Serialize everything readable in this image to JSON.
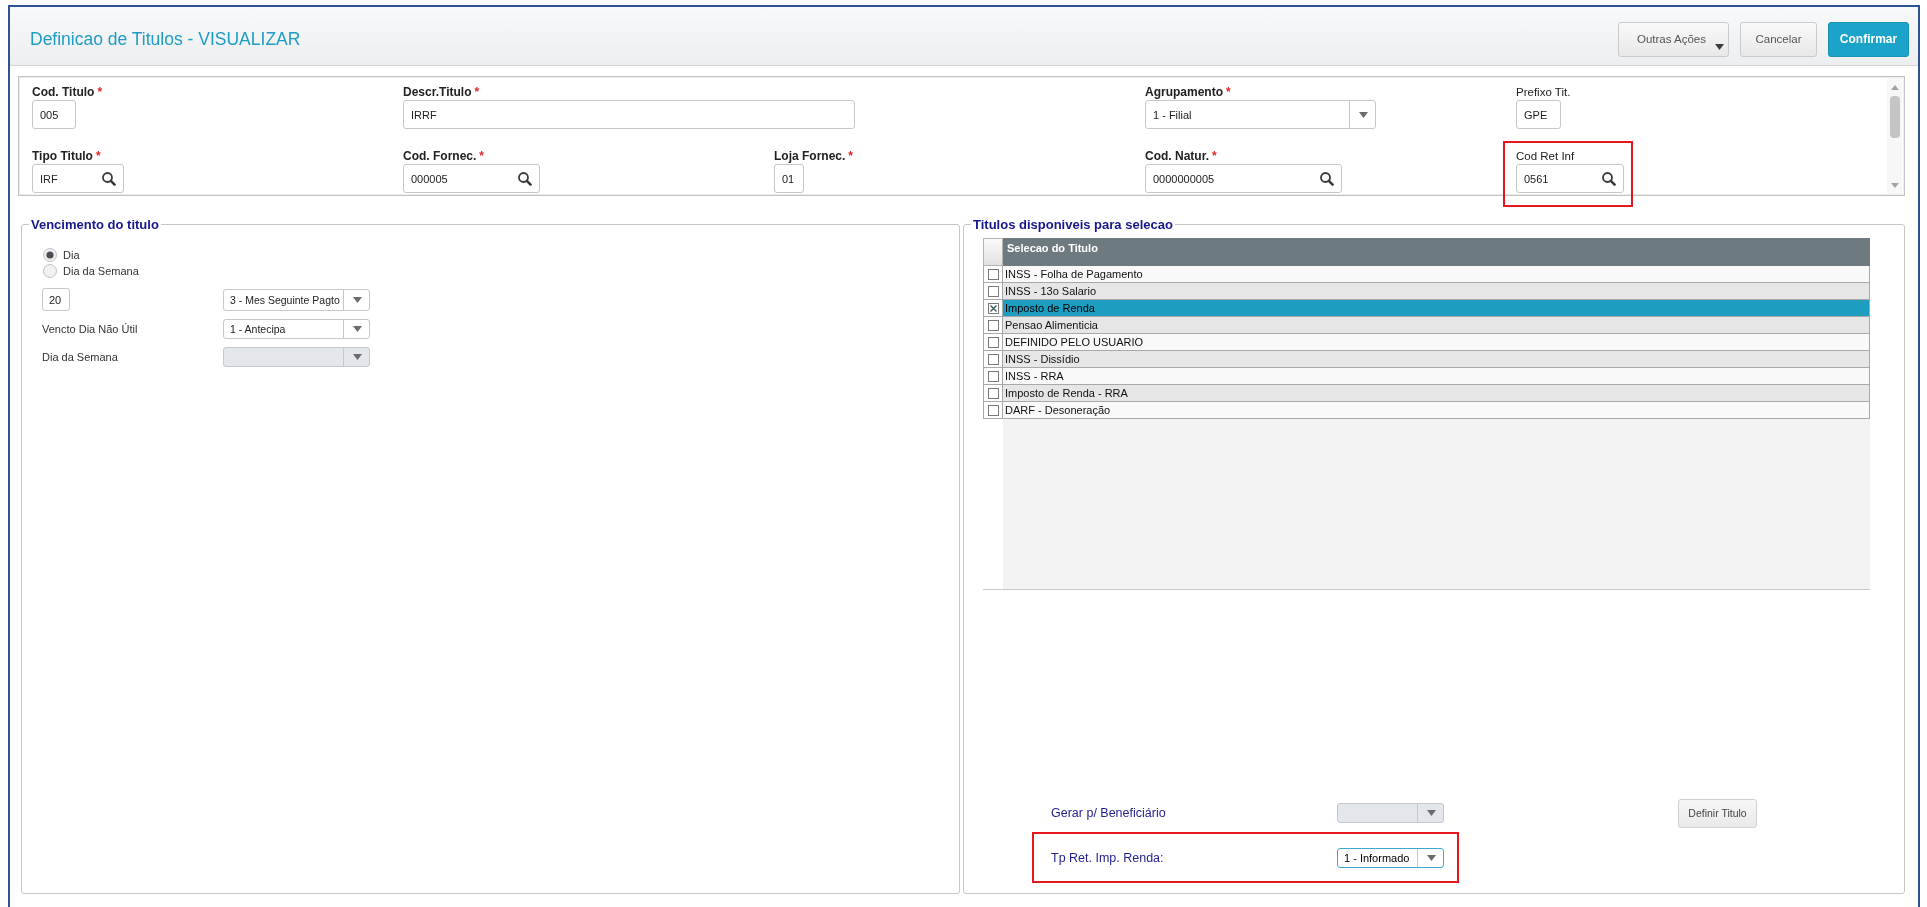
{
  "window": {
    "title": "Definicao de Titulos - VISUALIZAR"
  },
  "actions": [
    {
      "label": "Outras Ações",
      "kind": "menu"
    },
    {
      "label": "Cancelar",
      "kind": "cancel"
    },
    {
      "label": "Confirmar",
      "kind": "confirm"
    }
  ],
  "form": {
    "rows": [
      {
        "fields": [
          {
            "label": "Cod. Titulo",
            "required_mark": "*",
            "kind": "text",
            "value": "005",
            "highlighted": false
          },
          {
            "label": "Descr.Titulo",
            "required_mark": "*",
            "kind": "wide_text",
            "value": "IRRF",
            "highlighted": false
          },
          {
            "label": "Agrupamento",
            "required_mark": "*",
            "kind": "select",
            "value": "1 - Filial",
            "highlighted": false
          },
          {
            "label": "Prefixo Tit.",
            "kind": "text",
            "value": "GPE",
            "highlighted": false
          }
        ]
      },
      {
        "fields": [
          {
            "label": "Tipo Titulo",
            "required_mark": "*",
            "kind": "lookup",
            "value": "IRF",
            "highlighted": false
          },
          {
            "label": "Cod. Fornec.",
            "required_mark": "*",
            "kind": "lookup",
            "value": "000005",
            "highlighted": false
          },
          {
            "label": "Loja Fornec.",
            "required_mark": "*",
            "kind": "text",
            "value": "01",
            "highlighted": false
          },
          {
            "label": "Cod. Natur.",
            "required_mark": "*",
            "kind": "lookup",
            "value": "0000000005",
            "highlighted": false
          },
          {
            "label": "Cod Ret Inf",
            "kind": "lookup",
            "value": "0561",
            "highlighted": true
          }
        ]
      }
    ]
  },
  "due_date": {
    "legend": "Vencimento do titulo",
    "options": [
      {
        "label": "Dia",
        "selected": true
      },
      {
        "label": "Dia da Semana",
        "selected": false
      }
    ],
    "rows": [
      {
        "kind": "day",
        "value": "20",
        "select": {
          "value": "3 - Mes Seguinte Pagto",
          "disabled": false
        }
      },
      {
        "kind": "labeled",
        "label": "Vencto Dia Não Útil",
        "select": {
          "value": "1 - Antecipa",
          "disabled": false
        }
      },
      {
        "kind": "labeled",
        "label": "Dia da Semana",
        "select": {
          "disabled": true
        }
      }
    ]
  },
  "titles": {
    "legend": "Titulos disponiveis para selecao",
    "table": {
      "columns": [
        "Selecao do Titulo"
      ],
      "rows": [
        {
          "label": "INSS - Folha de Pagamento",
          "checked": false,
          "selected": false
        },
        {
          "label": "INSS - 13o Salario",
          "checked": false,
          "selected": false
        },
        {
          "label": "Imposto de Renda",
          "checked": true,
          "selected": true
        },
        {
          "label": "Pensao Alimenticia",
          "checked": false,
          "selected": false
        },
        {
          "label": "DEFINIDO PELO USUARIO",
          "checked": false,
          "selected": false
        },
        {
          "label": "INSS - Dissídio",
          "checked": false,
          "selected": false
        },
        {
          "label": "INSS - RRA",
          "checked": false,
          "selected": false
        },
        {
          "label": "Imposto de Renda - RRA",
          "checked": false,
          "selected": false
        },
        {
          "label": "DARF - Desoneração",
          "checked": false,
          "selected": false
        }
      ]
    },
    "beneficiary": {
      "label": "Gerar p/ Beneficiário",
      "disabled": true
    },
    "define_button": {
      "label": "Definir Titulo"
    },
    "tax_type": {
      "label": "Tp Ret. Imp. Renda:",
      "value": "1 - Informado",
      "disabled": false,
      "focused": true,
      "highlighted": true
    }
  }
}
